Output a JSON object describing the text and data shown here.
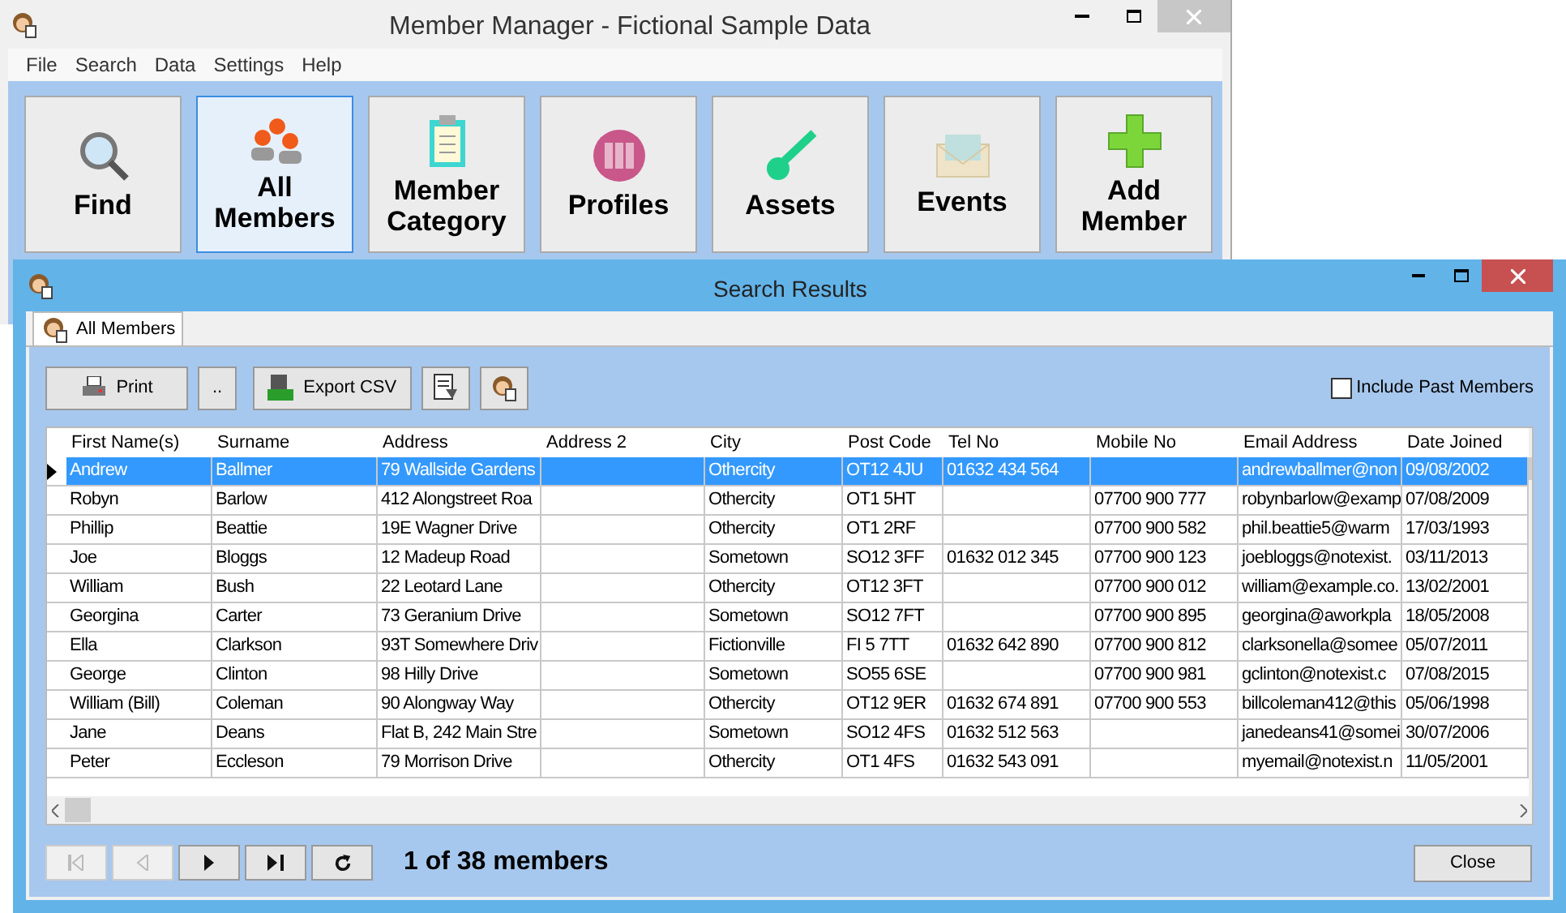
{
  "app": {
    "title": "Member Manager - Fictional Sample Data",
    "menu": [
      "File",
      "Search",
      "Data",
      "Settings",
      "Help"
    ],
    "toolbar": [
      {
        "kind": "find",
        "label": "Find",
        "selected": false
      },
      {
        "kind": "members",
        "label": "All Members",
        "selected": true
      },
      {
        "kind": "category",
        "label": "Member Category",
        "selected": false
      },
      {
        "kind": "profiles",
        "label": "Profiles",
        "selected": false
      },
      {
        "kind": "assets",
        "label": "Assets",
        "selected": false
      },
      {
        "kind": "events",
        "label": "Events",
        "selected": false
      },
      {
        "kind": "add",
        "label": "Add Member",
        "selected": false
      }
    ]
  },
  "dialog": {
    "title": "Search Results",
    "tabs": [
      {
        "label": "All Members",
        "selected": true
      }
    ],
    "actions": [
      {
        "kind": "print",
        "label": "Print"
      },
      {
        "kind": "more",
        "label": ".."
      },
      {
        "kind": "csv",
        "label": "Export CSV"
      },
      {
        "kind": "report"
      },
      {
        "kind": "person"
      }
    ],
    "include_past": {
      "label": "Include Past Members",
      "checked": false
    },
    "table": {
      "columns": [
        "First Name(s)",
        "Surname",
        "Address",
        "Address 2",
        "City",
        "Post Code",
        "Tel No",
        "Mobile No",
        "Email Address",
        "Date Joined"
      ],
      "rows": [
        {
          "selected": true,
          "cells": [
            "Andrew",
            "Ballmer",
            "79 Wallside Gardens",
            "",
            "Othercity",
            "OT12 4JU",
            "01632 434 564",
            "",
            "andrewballmer@non",
            "09/08/2002"
          ]
        },
        {
          "selected": false,
          "cells": [
            "Robyn",
            "Barlow",
            "412 Alongstreet Roa",
            "",
            "Othercity",
            "OT1 5HT",
            "",
            "07700 900 777",
            "robynbarlow@examp",
            "07/08/2009"
          ]
        },
        {
          "selected": false,
          "cells": [
            "Phillip",
            "Beattie",
            "19E Wagner Drive",
            "",
            "Othercity",
            "OT1 2RF",
            "",
            "07700 900 582",
            "phil.beattie5@warm",
            "17/03/1993"
          ]
        },
        {
          "selected": false,
          "cells": [
            "Joe",
            "Bloggs",
            "12 Madeup Road",
            "",
            "Sometown",
            "SO12 3FF",
            "01632 012 345",
            "07700 900 123",
            "joebloggs@notexist.",
            "03/11/2013"
          ]
        },
        {
          "selected": false,
          "cells": [
            "William",
            "Bush",
            "22 Leotard Lane",
            "",
            "Othercity",
            "OT12 3FT",
            "",
            "07700 900 012",
            "william@example.co.",
            "13/02/2001"
          ]
        },
        {
          "selected": false,
          "cells": [
            "Georgina",
            "Carter",
            "73 Geranium Drive",
            "",
            "Sometown",
            "SO12 7FT",
            "",
            "07700 900 895",
            "georgina@aworkpla",
            "18/05/2008"
          ]
        },
        {
          "selected": false,
          "cells": [
            "Ella",
            "Clarkson",
            "93T Somewhere Driv",
            "",
            "Fictionville",
            "FI 5 7TT",
            "01632 642 890",
            "07700 900 812",
            "clarksonella@somee",
            "05/07/2011"
          ]
        },
        {
          "selected": false,
          "cells": [
            "George",
            "Clinton",
            "98 Hilly Drive",
            "",
            "Sometown",
            "SO55 6SE",
            "",
            "07700 900 981",
            "gclinton@notexist.c",
            "07/08/2015"
          ]
        },
        {
          "selected": false,
          "cells": [
            "William (Bill)",
            "Coleman",
            "90 Alongway Way",
            "",
            "Othercity",
            "OT12 9ER",
            "01632 674 891",
            "07700 900 553",
            "billcoleman412@this",
            "05/06/1998"
          ]
        },
        {
          "selected": false,
          "cells": [
            "Jane",
            "Deans",
            "Flat B, 242 Main Stre",
            "",
            "Sometown",
            "SO12 4FS",
            "01632 512 563",
            "",
            "janedeans41@somei",
            "30/07/2006"
          ]
        },
        {
          "selected": false,
          "cells": [
            "Peter",
            "Eccleson",
            "79 Morrison Drive",
            "",
            "Othercity",
            "OT1 4FS",
            "01632 543 091",
            "",
            "myemail@notexist.n",
            "11/05/2001"
          ]
        }
      ]
    },
    "pager": {
      "buttons": [
        {
          "kind": "first",
          "disabled": true
        },
        {
          "kind": "prev",
          "disabled": true
        },
        {
          "kind": "next",
          "disabled": false
        },
        {
          "kind": "last",
          "disabled": false
        },
        {
          "kind": "refresh",
          "disabled": false
        }
      ],
      "status": "1 of 38 members"
    },
    "close": "Close"
  }
}
